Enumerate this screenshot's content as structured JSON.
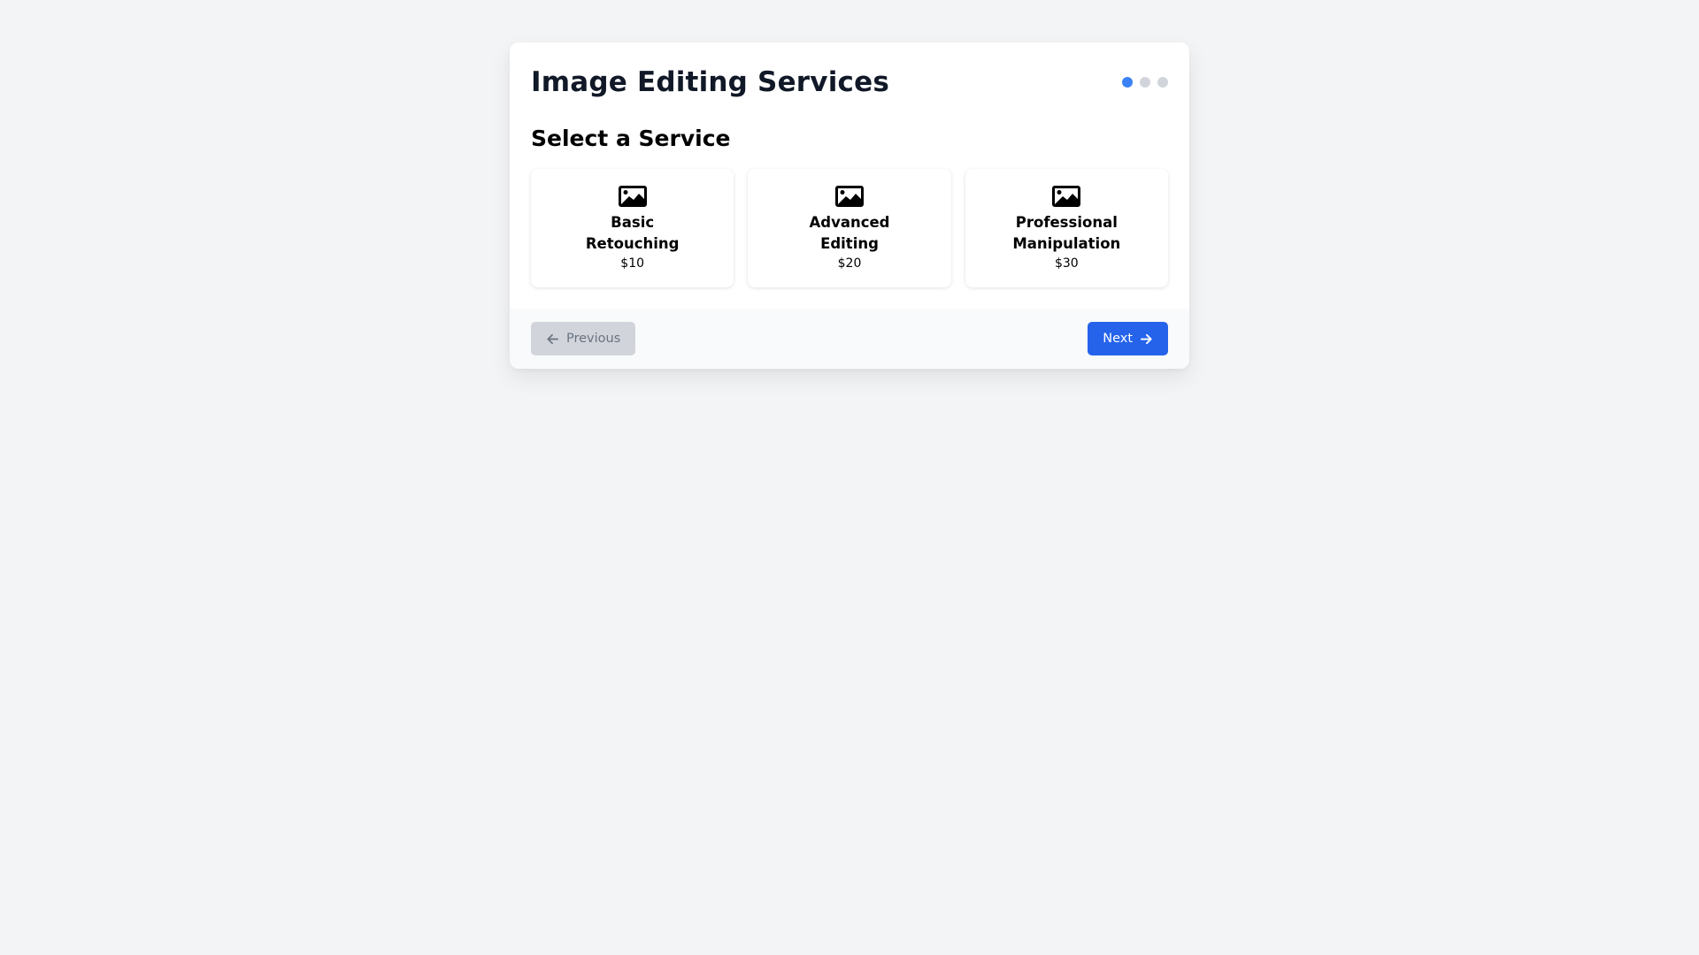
{
  "header": {
    "title": "Image Editing Services",
    "steps": [
      {
        "state": "active"
      },
      {
        "state": "inactive"
      },
      {
        "state": "inactive"
      }
    ]
  },
  "section": {
    "title": "Select a Service"
  },
  "services": [
    {
      "name": "Basic Retouching",
      "price": "$10",
      "icon": "image-icon"
    },
    {
      "name": "Advanced Editing",
      "price": "$20",
      "icon": "image-icon"
    },
    {
      "name": "Professional Manipulation",
      "price": "$30",
      "icon": "image-icon"
    }
  ],
  "footer": {
    "previous_label": "Previous",
    "next_label": "Next"
  },
  "colors": {
    "accent": "#2563eb",
    "step_active": "#3b82f6",
    "step_inactive": "#d1d5db",
    "disabled_button": "#d1d5db"
  }
}
